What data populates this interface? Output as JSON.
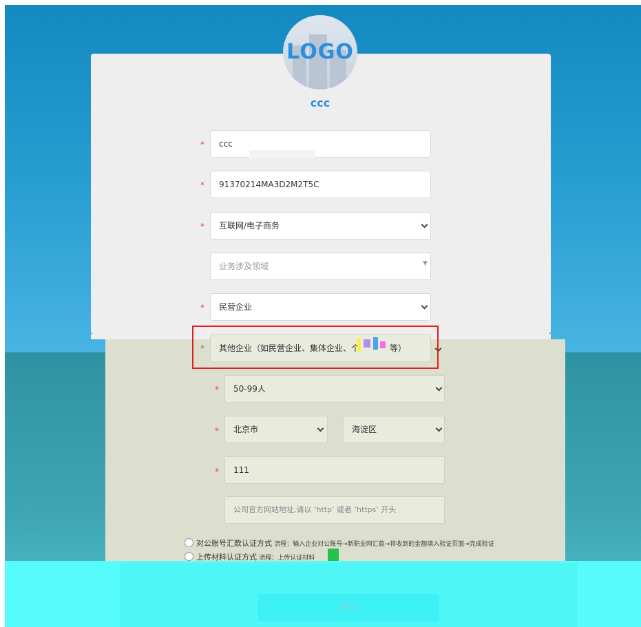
{
  "brand": {
    "logo_text": "LOGO",
    "company_name": "ccc",
    "accent_color": "#2b8fe0"
  },
  "form": {
    "company_name_value": "ccc",
    "credit_code_value": "91370214MA3D2M2T5C",
    "industry_value": "互联网/电子商务",
    "business_area_placeholder": "业务涉及领域",
    "enterprise_type_value": "民营企业",
    "enterprise_subtype_value": "其他企业（如民营企业、集体企业、个",
    "enterprise_subtype_tail": "等）",
    "staff_size_value": "50-99人",
    "province_value": "北京市",
    "district_value": "海淀区",
    "address_value": "111",
    "website_placeholder": "公司官方网站地址,请以 ‘http’ 或者 ‘https’ 开头"
  },
  "verification": {
    "option1_title": "对公账号汇款认证方式",
    "option1_desc": "流程：输入企业对公账号→新职业网汇款→将收到的金额填入验证页面→完成验证",
    "option2_title": "上传材料认证方式",
    "option2_desc": "流程：上传认证材料"
  },
  "submit_label": "提交"
}
